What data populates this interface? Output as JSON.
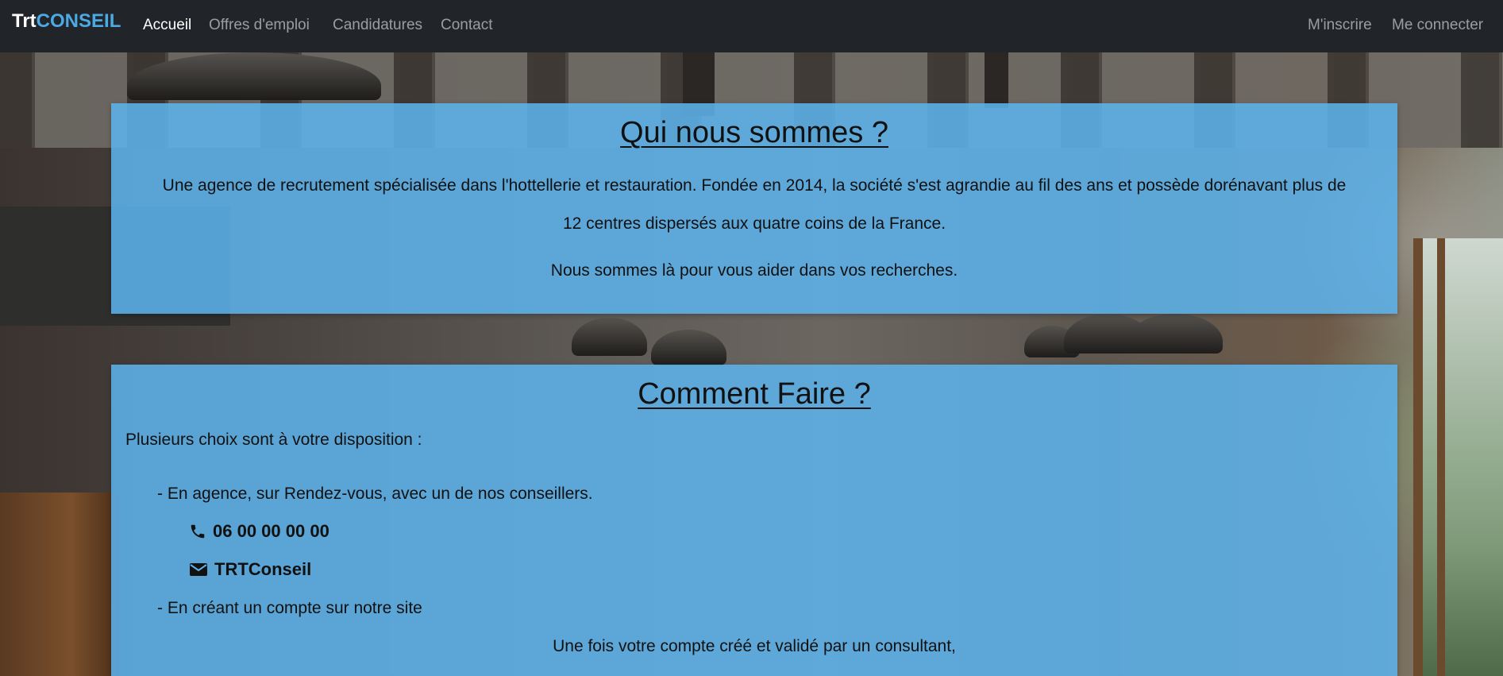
{
  "navbar": {
    "brand_prefix": "Trt",
    "brand_suffix": "CONSEIL",
    "links": [
      "Accueil",
      "Offres d'emploi",
      "Candidatures",
      "Contact"
    ],
    "active_link": "Accueil",
    "register": "M'inscrire",
    "login": "Me connecter"
  },
  "about": {
    "title": "Qui nous sommes ?",
    "description": "Une agence de recrutement spécialisée dans l'hottellerie et restauration. Fondée en 2014, la société s'est agrandie au fil des ans et possède dorénavant plus de 12 centres dispersés aux quatre coins de la France.",
    "help": "Nous sommes là pour vous aider dans vos recherches."
  },
  "howto": {
    "title": "Comment Faire ?",
    "intro": "Plusieurs choix sont à votre disposition :",
    "option_agency": "- En agence, sur Rendez-vous, avec un de nos conseillers.",
    "phone": "06 00 00 00 00",
    "email": "TRTConseil",
    "option_account": "- En créant un compte sur notre site",
    "outro": "Une fois votre compte créé et validé par un consultant,"
  },
  "icons": {
    "phone": "phone-icon",
    "email": "envelope-icon"
  },
  "colors": {
    "navbar_bg": "#212529",
    "brand_accent": "#4ba9e4",
    "card_bg": "#5cb2eb"
  }
}
